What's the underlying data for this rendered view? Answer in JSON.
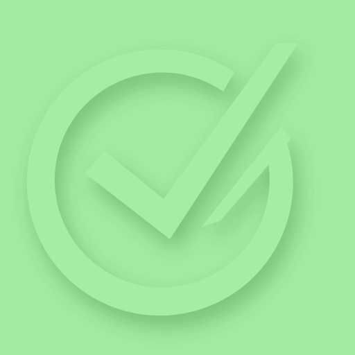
{
  "icon": {
    "name": "checkmark-circle-icon",
    "colors": {
      "background": "#a4eaa4",
      "glyph": "#a6eca6",
      "shadow": "#3c8a3c",
      "highlight": "#c8f6c8"
    }
  }
}
